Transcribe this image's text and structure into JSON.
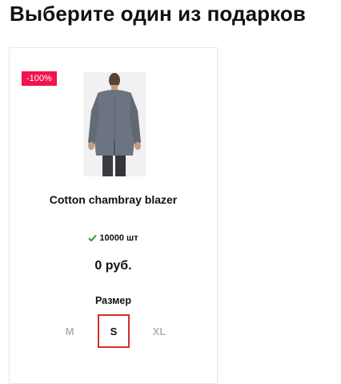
{
  "page": {
    "title": "Выберите один из подарков"
  },
  "gift": {
    "badge": "-100%",
    "name": "Cotton chambray blazer",
    "stock": "10000 шт",
    "price": "0 руб.",
    "size_label": "Размер",
    "sizes": [
      "M",
      "S",
      "XL"
    ],
    "selected_size": "S",
    "image_icon": "blazer-product-photo"
  },
  "colors": {
    "badge": "#f2134f",
    "check": "#2a9a36",
    "selected_border": "#d0312d",
    "inactive_size": "#b5b5b5"
  }
}
